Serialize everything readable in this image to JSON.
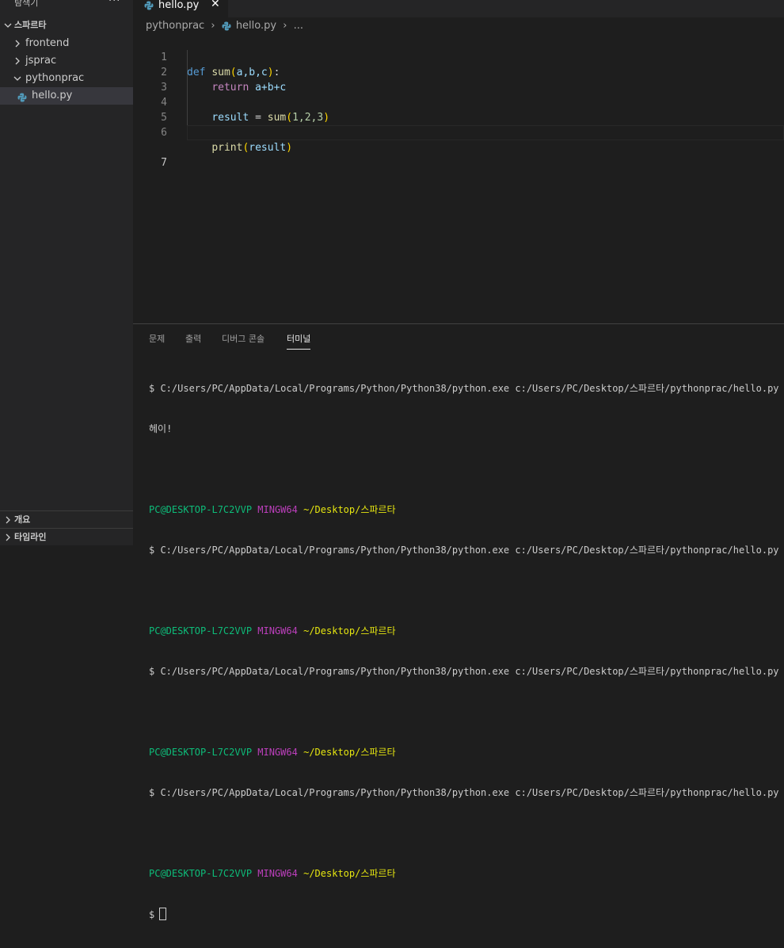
{
  "explorer": {
    "title": "탐색기",
    "more": "···",
    "workspace": "스파르타",
    "folders": [
      {
        "label": "frontend",
        "state": "collapsed"
      },
      {
        "label": "jsprac",
        "state": "collapsed"
      },
      {
        "label": "pythonprac",
        "state": "expanded"
      }
    ],
    "file": "hello.py",
    "sections": [
      "개요",
      "타임라인"
    ]
  },
  "tab": {
    "label": "hello.py",
    "close": "✕"
  },
  "breadcrumb": {
    "folder": "pythonprac",
    "sep1": "›",
    "file": "hello.py",
    "sep2": "›",
    "ellipsis": "..."
  },
  "editor": {
    "line_numbers": [
      "1",
      "2",
      "3",
      "4",
      "5",
      "6",
      "7"
    ],
    "current_line": 7,
    "code": {
      "l1": {
        "def": "def",
        "fn": "sum",
        "open": "(",
        "params": "a,b,c",
        "close": ")",
        "colon": ":"
      },
      "l2": {
        "kw": "return",
        "expr": "a+b+c"
      },
      "l4": {
        "var": "result",
        "eq": " = ",
        "fn": "sum",
        "open": "(",
        "args": "1,2,3",
        "close": ")"
      },
      "l6": {
        "fn": "print",
        "open": "(",
        "arg": "result",
        "close": ")"
      }
    }
  },
  "panel": {
    "tabs": [
      "문제",
      "출력",
      "디버그 콘솔",
      "터미널"
    ],
    "active_tab": "터미널"
  },
  "terminal": {
    "command": "$ C:/Users/PC/AppData/Local/Programs/Python/Python38/python.exe c:/Users/PC/Desktop/스파르타/pythonprac/hello.py",
    "output": "헤이!",
    "user_host": "PC@DESKTOP-L7C2VVP",
    "shell": "MINGW64",
    "path": "~/Desktop/스파르타",
    "prompt": "$"
  },
  "colors": {
    "accent": "#569cd6",
    "terminal_green": "#0dbc79",
    "terminal_magenta": "#bc3fbc",
    "terminal_yellow": "#e5e510"
  }
}
